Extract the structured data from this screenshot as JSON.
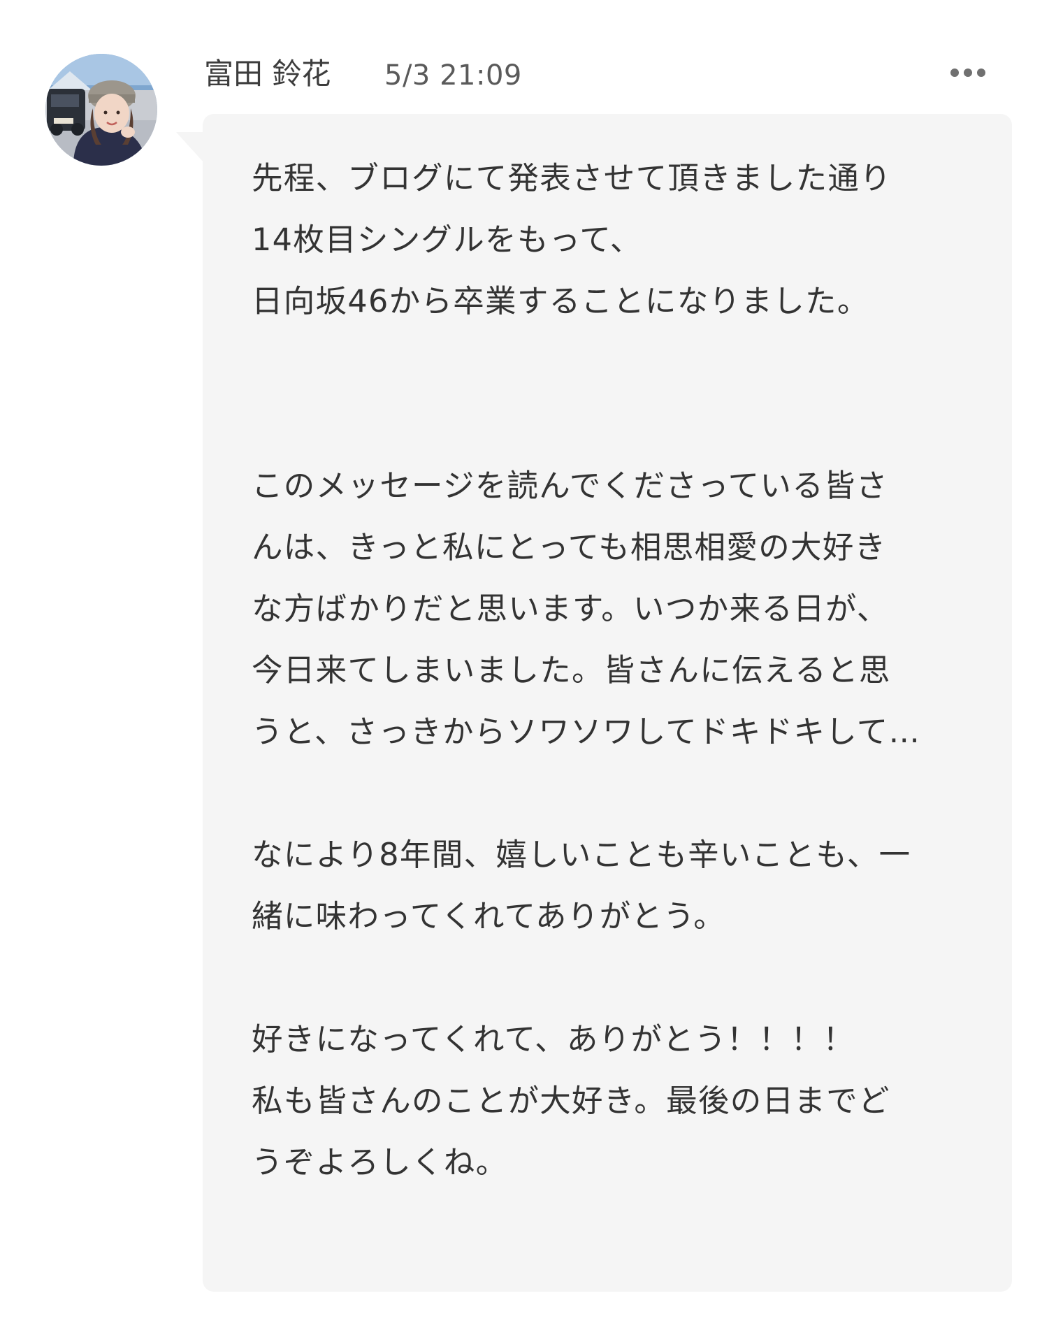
{
  "post": {
    "sender_name": "富田 鈴花",
    "timestamp": "5/3 21:09",
    "avatar_icon": "member-avatar-photo",
    "more_icon": "more-options-icon"
  },
  "message": {
    "lines": [
      "先程、ブログにて発表させて頂きました通り",
      "14枚目シングルをもって、",
      "日向坂46から卒業することになりました。",
      "",
      "",
      "このメッセージを読んでくださっている皆さ",
      "んは、きっと私にとっても相思相愛の大好き",
      "な方ばかりだと思います。いつか来る日が、",
      "今日来てしまいました。皆さんに伝えると思",
      "うと、さっきからソワソワしてドキドキして…",
      "",
      "なにより8年間、嬉しいことも辛いことも、一",
      "緒に味わってくれてありがとう。",
      "",
      "好きになってくれて、ありがとう！！！！",
      "私も皆さんのことが大好き。最後の日までど",
      "うぞよろしくね。"
    ]
  },
  "colors": {
    "bubble_background": "#f5f5f5",
    "text": "#333333",
    "meta_text": "#5a5a5a"
  }
}
